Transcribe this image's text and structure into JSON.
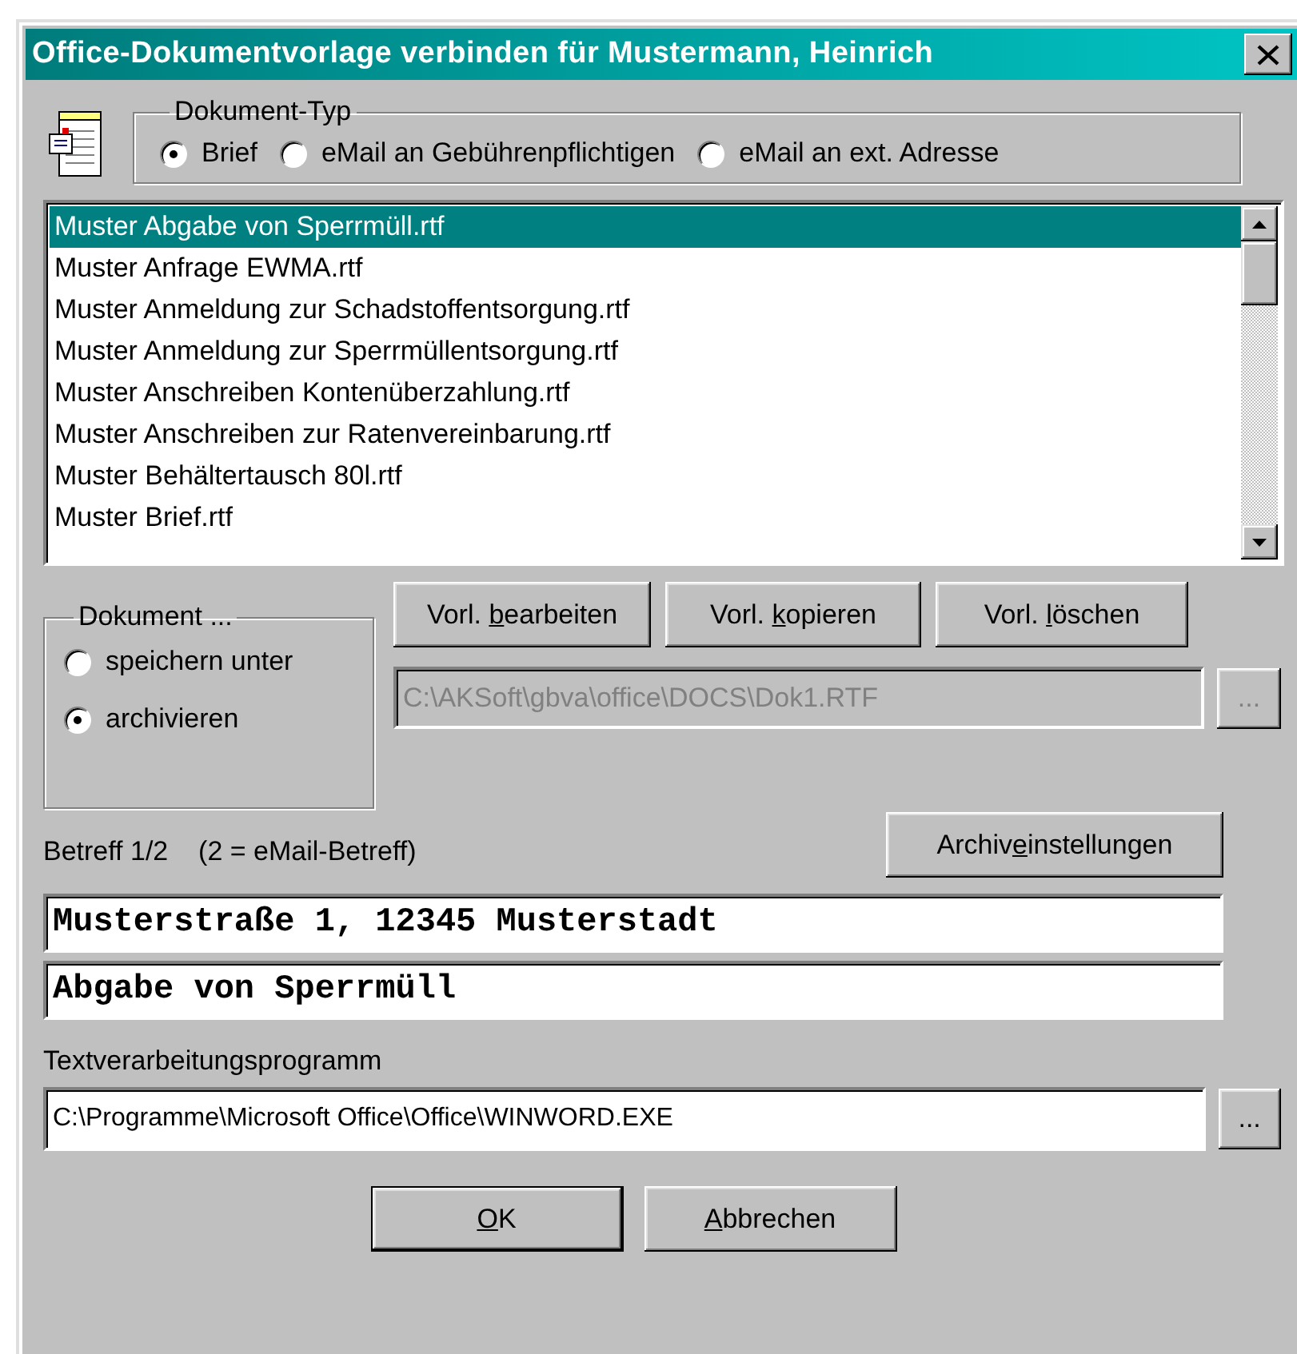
{
  "window": {
    "title": "Office-Dokumentvorlage verbinden für Mustermann, Heinrich"
  },
  "doc_type": {
    "legend": "Dokument-Typ",
    "options": [
      {
        "label": "Brief",
        "selected": true
      },
      {
        "label": "eMail an Gebührenpflichtigen",
        "selected": false
      },
      {
        "label": "eMail an ext. Adresse",
        "selected": false
      }
    ]
  },
  "templates": {
    "items": [
      {
        "label": "Muster Abgabe von Sperrmüll.rtf",
        "selected": true
      },
      {
        "label": "Muster Anfrage EWMA.rtf",
        "selected": false
      },
      {
        "label": "Muster Anmeldung zur Schadstoffentsorgung.rtf",
        "selected": false
      },
      {
        "label": "Muster Anmeldung zur Sperrmüllentsorgung.rtf",
        "selected": false
      },
      {
        "label": "Muster Anschreiben Kontenüberzahlung.rtf",
        "selected": false
      },
      {
        "label": "Muster Anschreiben zur Ratenvereinbarung.rtf",
        "selected": false
      },
      {
        "label": "Muster Behältertausch 80l.rtf",
        "selected": false
      },
      {
        "label": "Muster Brief.rtf",
        "selected": false
      }
    ]
  },
  "template_buttons": [
    {
      "before": "Vorl. ",
      "key": "b",
      "after": "earbeiten"
    },
    {
      "before": "Vorl. ",
      "key": "k",
      "after": "opieren"
    },
    {
      "before": "Vorl. ",
      "key": "l",
      "after": "öschen"
    }
  ],
  "document": {
    "legend": "Dokument ...",
    "options": [
      {
        "label": "speichern unter",
        "selected": false
      },
      {
        "label": "archivieren",
        "selected": true
      }
    ]
  },
  "path_field": {
    "value": "C:\\AKSoft\\gbva\\office\\DOCS\\Dok1.RTF",
    "disabled": true
  },
  "path_browse": {
    "label": "...",
    "disabled": true
  },
  "subject": {
    "label": "Betreff 1/2",
    "hint": "(2 = eMail-Betreff)",
    "archive_button": {
      "before": "Archiv",
      "key": "e",
      "after": "instellungen"
    },
    "lines": [
      "Musterstraße 1, 12345 Musterstadt",
      "Abgabe von Sperrmüll"
    ]
  },
  "word_processor": {
    "label": "Textverarbeitungsprogramm",
    "value": "C:\\Programme\\Microsoft Office\\Office\\WINWORD.EXE",
    "browse": {
      "label": "...",
      "disabled": false
    }
  },
  "dialog_buttons": [
    {
      "key": "O",
      "after": "K",
      "default": true
    },
    {
      "key": "A",
      "after": "bbrechen",
      "default": false
    }
  ]
}
